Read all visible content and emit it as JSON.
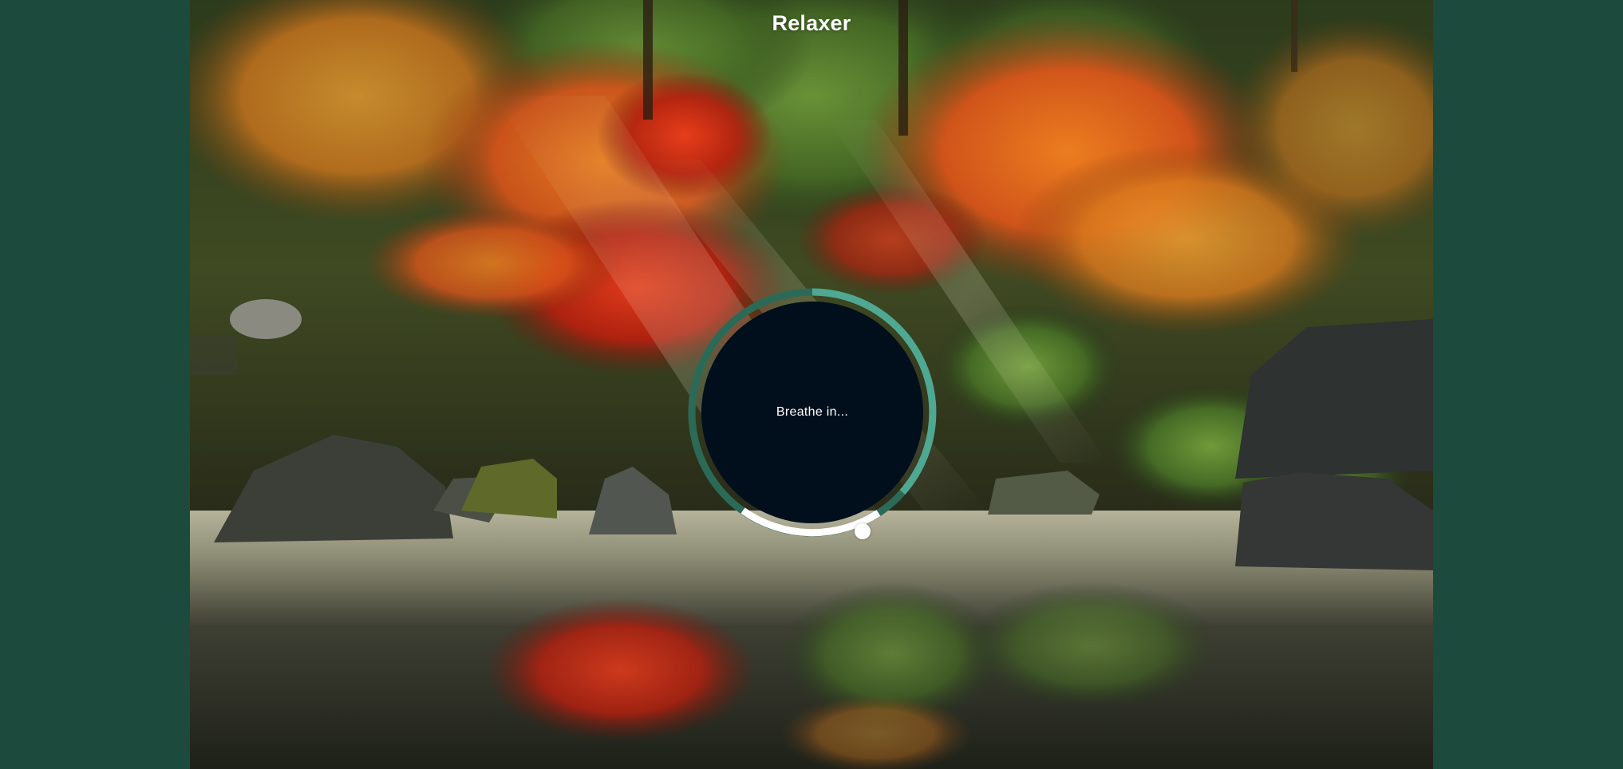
{
  "app": {
    "title": "Relaxer"
  },
  "breath": {
    "instruction": "Breathe in..."
  },
  "colors": {
    "side_background": "#1c4a3d",
    "circle_fill": "#010f1d",
    "ring_light": "#4fa892",
    "ring_dark": "#2c6a58",
    "ring_hold": "#ffffff",
    "pointer": "#ffffff"
  },
  "icons": {
    "pointer": "pointer-dot-icon"
  }
}
